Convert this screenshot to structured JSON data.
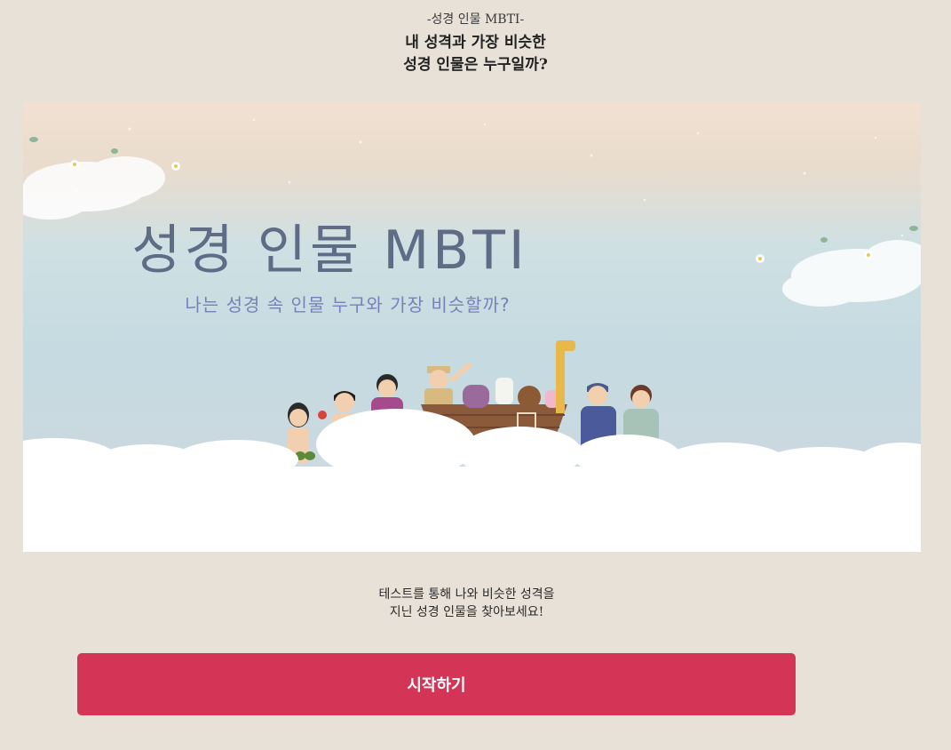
{
  "header": {
    "kicker": "-성경 인물 MBTI-",
    "headline_line1": "내 성격과 가장 비슷한",
    "headline_line2": "성경 인물은 누구일까?"
  },
  "hero": {
    "title": "성경 인물 MBTI",
    "subtitle": "나는 성경 속 인물 누구와 가장 비슷할까?"
  },
  "description": {
    "line1": "테스트를 통해 나와 비슷한 성격을",
    "line2": "지닌 성경 인물을 찾아보세요!"
  },
  "start_button": {
    "label": "시작하기"
  },
  "colors": {
    "background": "#e8e1d8",
    "button": "#d43455",
    "hero_title": "#5f6c86",
    "hero_subtitle": "#7a7fb8"
  }
}
